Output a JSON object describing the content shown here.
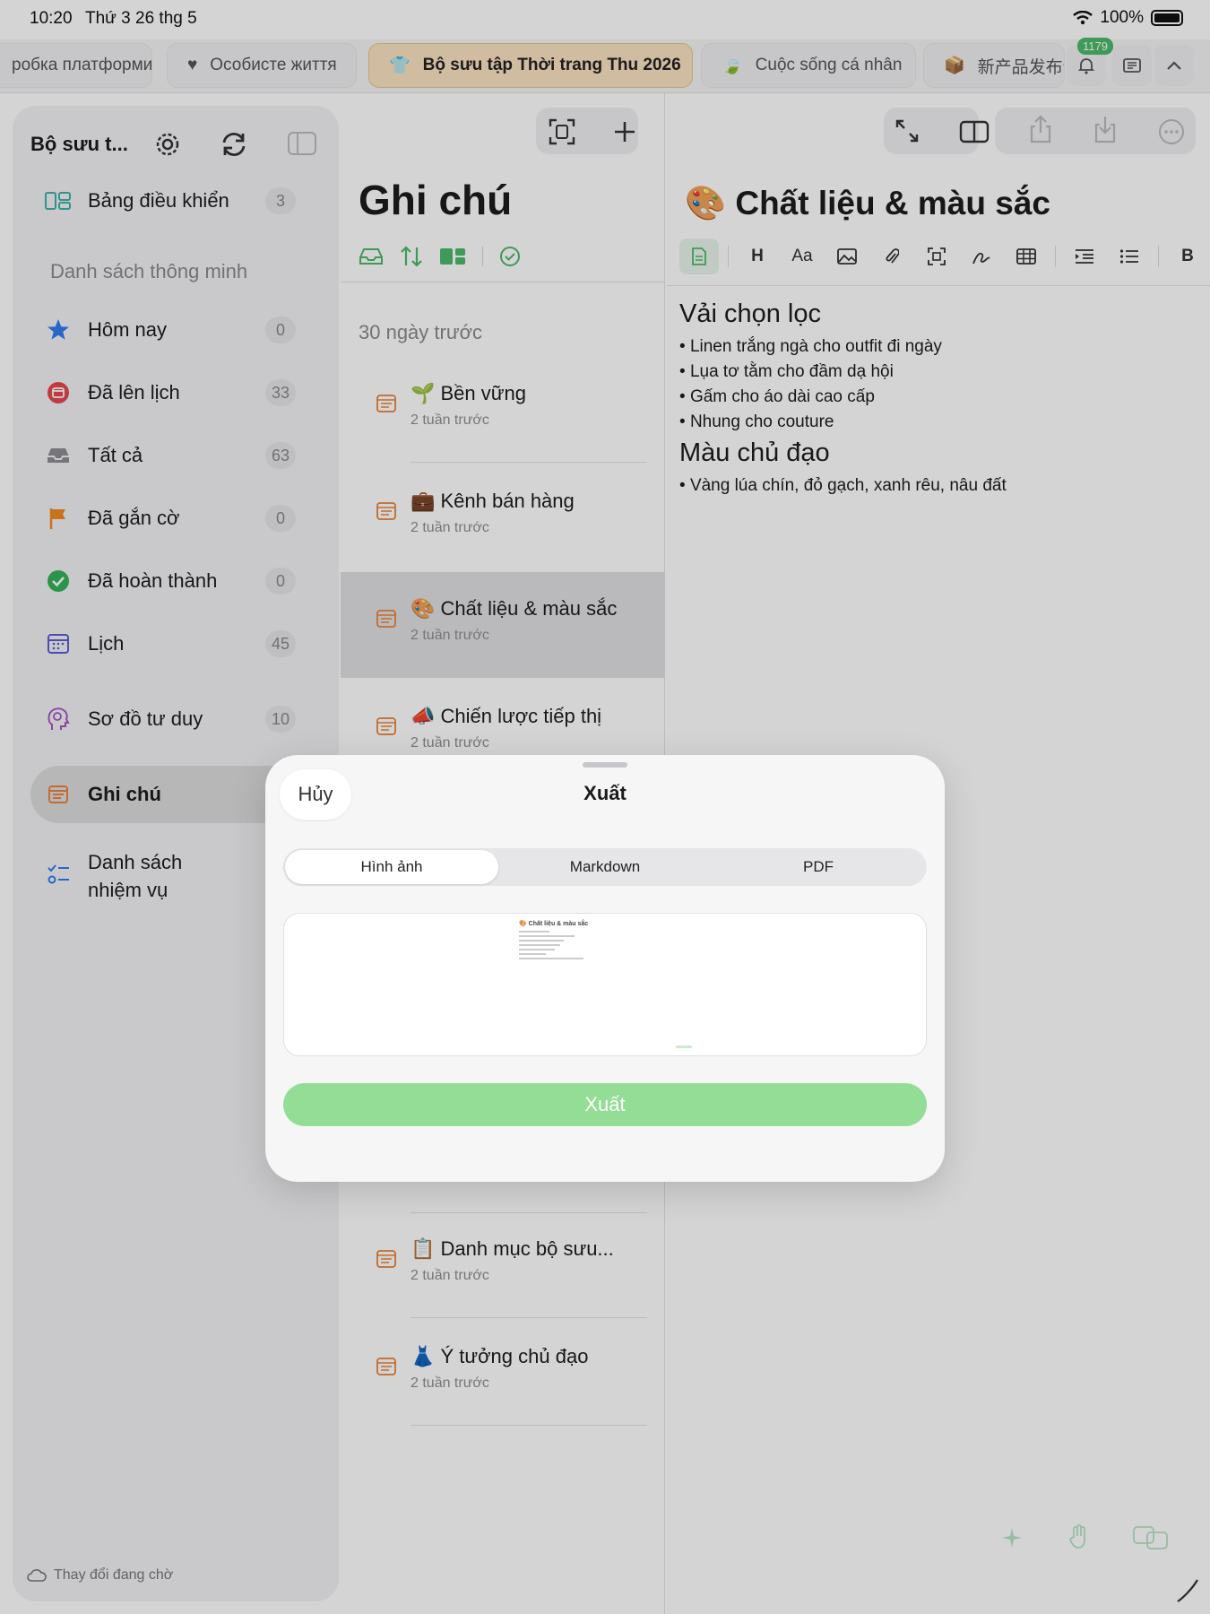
{
  "status": {
    "time": "10:20",
    "date": "Thứ 3 26 thg 5",
    "battery": "100%"
  },
  "tabs": [
    {
      "label": "робка платформи"
    },
    {
      "label": "Особисте життя"
    },
    {
      "label": "Bộ sưu tập Thời trang Thu 2026"
    },
    {
      "label": "Cuộc sống cá nhân"
    },
    {
      "label": "新产品发布计"
    }
  ],
  "notifications": {
    "count": "1179"
  },
  "sidebar": {
    "title": "Bộ sưu t...",
    "dashboard": {
      "label": "Bảng điều khiển",
      "count": "3"
    },
    "section": "Danh sách thông minh",
    "items": [
      {
        "label": "Hôm nay",
        "count": "0"
      },
      {
        "label": "Đã lên lịch",
        "count": "33"
      },
      {
        "label": "Tất cả",
        "count": "63"
      },
      {
        "label": "Đã gắn cờ",
        "count": "0"
      },
      {
        "label": "Đã hoàn thành",
        "count": "0"
      },
      {
        "label": "Lịch",
        "count": "45"
      },
      {
        "label": "Sơ đồ tư duy",
        "count": "10"
      },
      {
        "label": "Ghi chú"
      },
      {
        "label": "Danh sách nhiệm vụ"
      }
    ],
    "footer": "Thay đổi đang chờ"
  },
  "notes": {
    "title": "Ghi chú",
    "section": "30 ngày trước",
    "items": [
      {
        "title": "🌱 Bền vững",
        "sub": "2 tuần trước"
      },
      {
        "title": "💼 Kênh bán hàng",
        "sub": "2 tuần trước"
      },
      {
        "title": "🎨 Chất liệu & màu sắc",
        "sub": "2 tuần trước"
      },
      {
        "title": "📣 Chiến lược tiếp thị",
        "sub": "2 tuần trước"
      },
      {
        "title": "📋 Danh mục bộ sưu...",
        "sub": "2 tuần trước"
      },
      {
        "title": "👗 Ý tưởng chủ đạo",
        "sub": "2 tuần trước"
      }
    ]
  },
  "editor": {
    "title": "🎨 Chất liệu & màu sắc",
    "heading1": "Vải chọn lọc",
    "list1": [
      "Linen trắng ngà cho outfit đi ngày",
      "Lụa tơ tằm cho đầm dạ hội",
      "Gấm cho áo dài cao cấp",
      "Nhung cho couture"
    ],
    "heading2": "Màu chủ đạo",
    "list2": [
      "Vàng lúa chín, đỏ gạch, xanh rêu, nâu đất"
    ],
    "toolbar": {
      "heading": "H",
      "font": "Aa",
      "bold": "B"
    }
  },
  "export_sheet": {
    "cancel": "Hủy",
    "title": "Xuất",
    "formats": [
      "Hình ảnh",
      "Markdown",
      "PDF"
    ],
    "selected": "Hình ảnh",
    "preview_title": "🎨 Chất liệu & màu sắc",
    "button": "Xuất"
  },
  "colors": {
    "accent": "#4cb86a",
    "export_button": "#93dd97",
    "active_tab": "#fbe3c2",
    "note_icon": "#e8833a"
  }
}
